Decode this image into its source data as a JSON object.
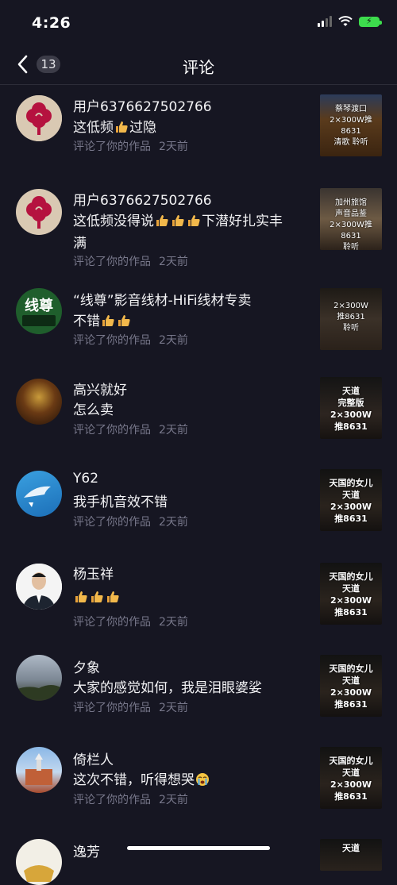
{
  "status": {
    "time": "4:26"
  },
  "nav": {
    "count": "13",
    "title": "评论"
  },
  "comments": [
    {
      "name": "用户6376627502766",
      "text": "这低频",
      "text_after": "过隐",
      "thumbs": 1,
      "meta_action": "评论了你的作品",
      "meta_time": "2天前",
      "thumb_caption": "蔡琴渡口\n2×300W推8631\n清歌  聆听"
    },
    {
      "name": "用户6376627502766",
      "text": "这低频没得说",
      "text_after": "下潜好扎实丰满",
      "thumbs": 3,
      "meta_action": "评论了你的作品",
      "meta_time": "2天前",
      "thumb_caption": "加州旅馆\n声音品鉴\n2×300W推8631\n聆听"
    },
    {
      "name": "“线尊”影音线材-HiFi线材专卖",
      "text": "不错",
      "text_after": "",
      "thumbs": 2,
      "meta_action": "评论了你的作品",
      "meta_time": "2天前",
      "thumb_caption": "2×300W\n推8631\n聆听"
    },
    {
      "name": "高兴就好",
      "text": "怎么卖",
      "text_after": "",
      "thumbs": 0,
      "meta_action": "评论了你的作品",
      "meta_time": "2天前",
      "thumb_caption": "天道\n完整版\n2×300W\n推8631"
    },
    {
      "name": "Y62",
      "text": "我手机音效不错",
      "text_after": "",
      "thumbs": 0,
      "meta_action": "评论了你的作品",
      "meta_time": "2天前",
      "thumb_caption": "天国的女儿\n天道\n2×300W\n推8631"
    },
    {
      "name": "杨玉祥",
      "text": "",
      "text_after": "",
      "thumbs": 3,
      "meta_action": "评论了你的作品",
      "meta_time": "2天前",
      "thumb_caption": "天国的女儿\n天道\n2×300W\n推8631"
    },
    {
      "name": "夕象",
      "text": "大家的感觉如何，我是泪眼婆娑",
      "text_after": "",
      "thumbs": 0,
      "meta_action": "评论了你的作品",
      "meta_time": "2天前",
      "thumb_caption": "天国的女儿\n天道\n2×300W\n推8631"
    },
    {
      "name": "倚栏人",
      "text": "这次不错，听得想哭",
      "text_after": "",
      "thumbs": 0,
      "cry": true,
      "meta_action": "评论了你的作品",
      "meta_time": "2天前",
      "thumb_caption": "天国的女儿\n天道\n2×300W\n推8631"
    },
    {
      "name": "逸芳",
      "text": "",
      "text_after": "",
      "thumbs": 0,
      "meta_action": "",
      "meta_time": "",
      "thumb_caption": "天道"
    }
  ],
  "avatars": {
    "1": {
      "label": "线尊"
    }
  },
  "icons": {
    "back": "chevron-left-icon",
    "thumb": "thumbs-up-emoji",
    "cry": "loudly-crying-emoji",
    "signal": "cellular-signal-icon",
    "wifi": "wifi-icon",
    "battery": "battery-charging-icon"
  },
  "colors": {
    "background": "#161622",
    "meta": "#77778a",
    "battery": "#3ddc4d"
  }
}
